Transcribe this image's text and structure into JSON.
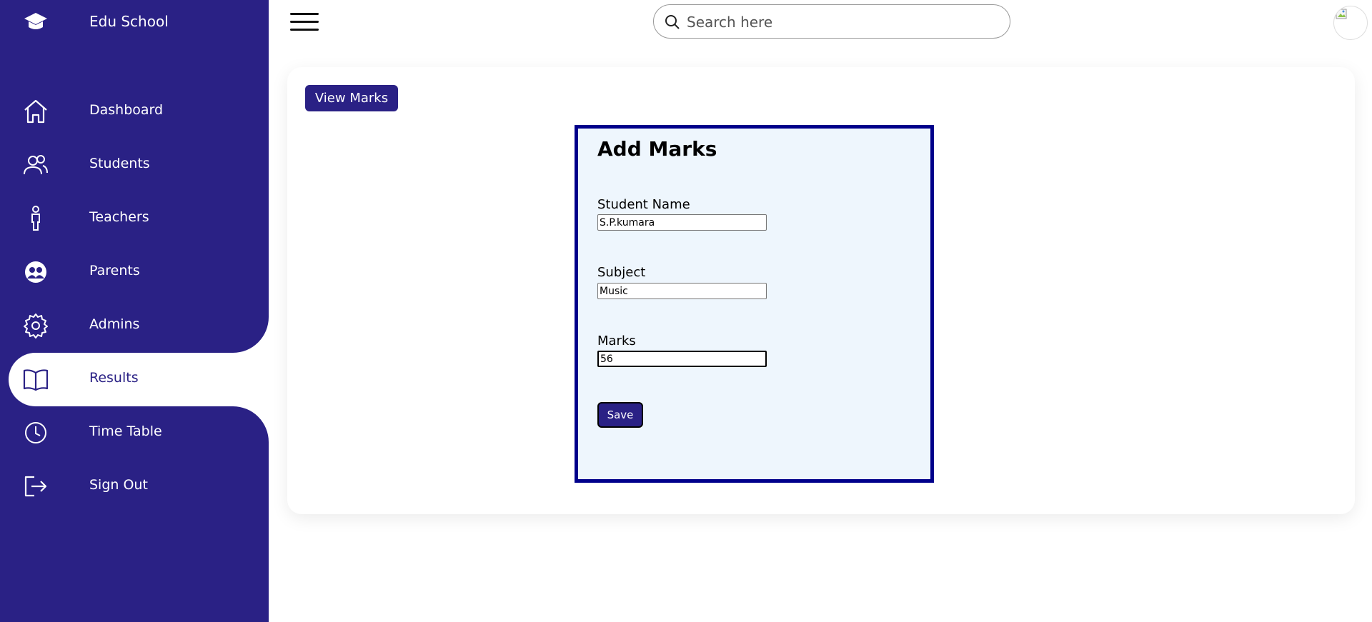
{
  "brand": {
    "name": "Edu School",
    "icon": "graduation-cap-icon"
  },
  "sidebar": {
    "items": [
      {
        "label": "Dashboard",
        "icon": "home-icon"
      },
      {
        "label": "Students",
        "icon": "users-icon"
      },
      {
        "label": "Teachers",
        "icon": "person-icon"
      },
      {
        "label": "Parents",
        "icon": "people-circle-icon"
      },
      {
        "label": "Admins",
        "icon": "gear-icon"
      },
      {
        "label": "Results",
        "icon": "book-icon",
        "active": true
      },
      {
        "label": "Time Table",
        "icon": "clock-icon"
      },
      {
        "label": "Sign Out",
        "icon": "sign-out-icon"
      }
    ]
  },
  "topbar": {
    "menu_icon": "hamburger-menu-icon",
    "search": {
      "placeholder": "Search here",
      "value": ""
    }
  },
  "main": {
    "view_marks_label": "View Marks",
    "form": {
      "title": "Add Marks",
      "student_name_label": "Student Name",
      "student_name_value": "S.P.kumara",
      "subject_label": "Subject",
      "subject_value": "Music",
      "marks_label": "Marks",
      "marks_value": "56",
      "save_label": "Save"
    }
  },
  "colors": {
    "sidebar_bg": "#2a2185",
    "form_bg": "#eef6fd",
    "form_border": "#00008b"
  }
}
